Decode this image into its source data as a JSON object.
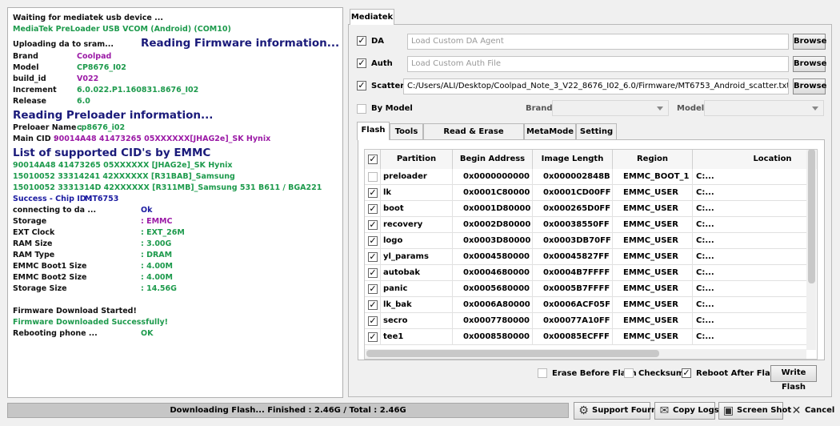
{
  "log": {
    "lines": [
      {
        "t": "Waiting for mediatek usb device ...",
        "c": "k"
      },
      {
        "t": "MediaTek PreLoader USB VCOM (Android) (COM10)",
        "c": "g"
      },
      {
        "t": "Uploading da to sram...",
        "c": "k"
      },
      {
        "t": "Brand",
        "c": "k"
      },
      {
        "t": "Coolpad",
        "c": "p"
      },
      {
        "t": "Model",
        "c": "k"
      },
      {
        "t": "CP8676_I02",
        "c": "g"
      },
      {
        "t": "build_id",
        "c": "k"
      },
      {
        "t": "V022",
        "c": "p"
      },
      {
        "t": "Increment",
        "c": "k"
      },
      {
        "t": "6.0.022.P1.160831.8676_I02",
        "c": "g"
      },
      {
        "t": "Release",
        "c": "k"
      },
      {
        "t": "6.0",
        "c": "g"
      },
      {
        "t": "Preloaer Name :",
        "c": "k"
      },
      {
        "t": "cp8676_i02",
        "c": "g"
      },
      {
        "t": "Main CID :",
        "c": "k"
      },
      {
        "t": "90014A48 41473265 05XXXXXX[JHAG2e]_SK Hynix",
        "c": "p"
      },
      {
        "t": "90014A48 41473265 05XXXXXX [JHAG2e]_SK Hynix",
        "c": "g"
      },
      {
        "t": "15010052 33314241 42XXXXXX [R31BAB]_Samsung",
        "c": "g"
      },
      {
        "t": "15010052 3331314D 42XXXXXX [R311MB]_Samsung 531 B611 / BGA221",
        "c": "g"
      },
      {
        "t": "Success - Chip ID  :",
        "c": "b"
      },
      {
        "t": "MT6753",
        "c": "b"
      },
      {
        "t": "connecting to da ...",
        "c": "k"
      },
      {
        "t": "Ok",
        "c": "b"
      },
      {
        "t": "Storage",
        "c": "k"
      },
      {
        "t": ": EMMC",
        "c": "p"
      },
      {
        "t": "EXT Clock",
        "c": "k"
      },
      {
        "t": ": EXT_26M",
        "c": "g"
      },
      {
        "t": "RAM Size",
        "c": "k"
      },
      {
        "t": ": 3.00G",
        "c": "g"
      },
      {
        "t": "RAM Type",
        "c": "k"
      },
      {
        "t": ": DRAM",
        "c": "g"
      },
      {
        "t": "EMMC Boot1 Size",
        "c": "k"
      },
      {
        "t": ": 4.00M",
        "c": "g"
      },
      {
        "t": "EMMC Boot2 Size",
        "c": "k"
      },
      {
        "t": ": 4.00M",
        "c": "g"
      },
      {
        "t": "Storage Size",
        "c": "k"
      },
      {
        "t": ": 14.56G",
        "c": "g"
      },
      {
        "t": "Firmware Download Started!",
        "c": "k"
      },
      {
        "t": "Firmware Downloaded Successfully!",
        "c": "g"
      },
      {
        "t": "Rebooting phone ...",
        "c": "k"
      },
      {
        "t": "OK",
        "c": "g"
      }
    ],
    "headings": [
      "Reading Firmware information...",
      "Reading Preloader information...",
      "List of supported CID's by EMMC"
    ]
  },
  "tab_main": "Mediatek",
  "da": {
    "label": "DA",
    "placeholder": "Load Custom DA Agent",
    "browse": "Browse"
  },
  "auth": {
    "label": "Auth",
    "placeholder": "Load Custom Auth File",
    "browse": "Browse"
  },
  "scatter": {
    "label": "Scatter",
    "value": "C:/Users/ALI/Desktop/Coolpad_Note_3_V22_8676_I02_6.0/Firmware/MT6753_Android_scatter.txt",
    "browse": "Browse"
  },
  "by_model": {
    "label": "By Model",
    "brand": "Brand",
    "model": "Model"
  },
  "tabs": [
    "Flash",
    "Tools",
    "Read & Erase Operation",
    "MetaMode",
    "Setting"
  ],
  "table": {
    "headers": [
      "Partition",
      "Begin Address",
      "Image Length",
      "Region",
      "Location"
    ],
    "rows": [
      {
        "c": false,
        "p": "preloader",
        "b": "0x0000000000",
        "l": "0x000002848B",
        "r": "EMMC_BOOT_1",
        "loc": "C:..."
      },
      {
        "c": true,
        "p": "lk",
        "b": "0x0001C80000",
        "l": "0x0001CD00FF",
        "r": "EMMC_USER",
        "loc": "C:..."
      },
      {
        "c": true,
        "p": "boot",
        "b": "0x0001D80000",
        "l": "0x000265D0FF",
        "r": "EMMC_USER",
        "loc": "C:..."
      },
      {
        "c": true,
        "p": "recovery",
        "b": "0x0002D80000",
        "l": "0x00038550FF",
        "r": "EMMC_USER",
        "loc": "C:..."
      },
      {
        "c": true,
        "p": "logo",
        "b": "0x0003D80000",
        "l": "0x0003DB70FF",
        "r": "EMMC_USER",
        "loc": "C:..."
      },
      {
        "c": true,
        "p": "yl_params",
        "b": "0x0004580000",
        "l": "0x00045827FF",
        "r": "EMMC_USER",
        "loc": "C:..."
      },
      {
        "c": true,
        "p": "autobak",
        "b": "0x0004680000",
        "l": "0x0004B7FFFF",
        "r": "EMMC_USER",
        "loc": "C:..."
      },
      {
        "c": true,
        "p": "panic",
        "b": "0x0005680000",
        "l": "0x0005B7FFFF",
        "r": "EMMC_USER",
        "loc": "C:..."
      },
      {
        "c": true,
        "p": "lk_bak",
        "b": "0x0006A80000",
        "l": "0x0006ACF05F",
        "r": "EMMC_USER",
        "loc": "C:..."
      },
      {
        "c": true,
        "p": "secro",
        "b": "0x0007780000",
        "l": "0x00077A10FF",
        "r": "EMMC_USER",
        "loc": "C:..."
      },
      {
        "c": true,
        "p": "tee1",
        "b": "0x0008580000",
        "l": "0x00085ECFFF",
        "r": "EMMC_USER",
        "loc": "C:..."
      }
    ]
  },
  "options": {
    "erase": "Erase Before Flash",
    "checksum": "Checksum",
    "reboot": "Reboot After Flash",
    "write": "Write Flash"
  },
  "status": "Downloading Flash... Finished : 2.46G / Total : 2.46G",
  "buttons": {
    "support": "Support Fourm",
    "copy": "Copy Logs",
    "shot": "Screen Shot",
    "cancel": "Cancel"
  }
}
